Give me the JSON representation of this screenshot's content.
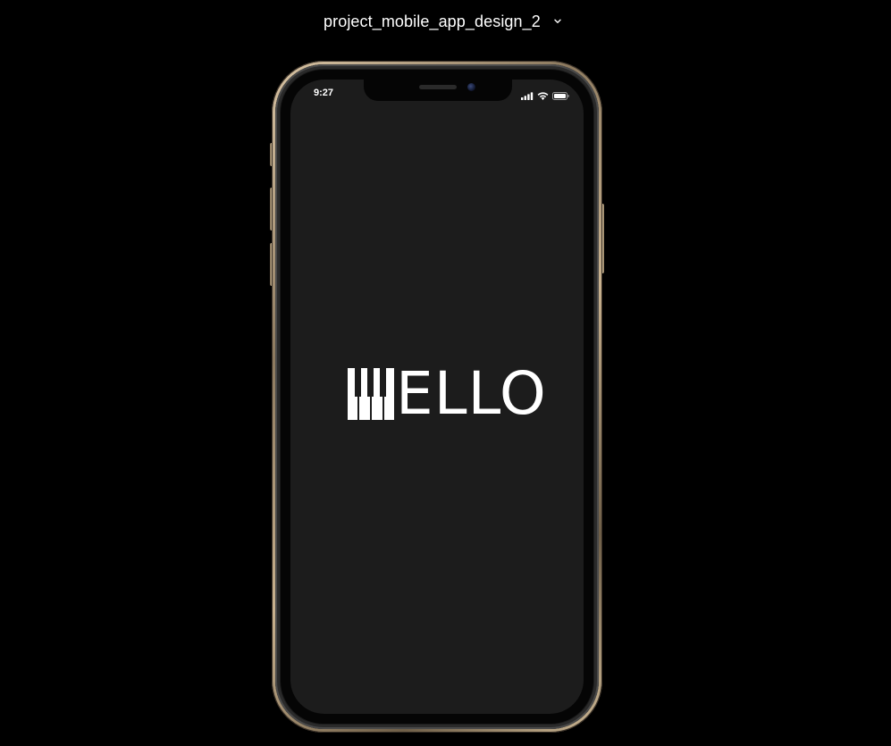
{
  "header": {
    "file_name": "project_mobile_app_design_2",
    "dropdown_icon": "chevron-down-icon"
  },
  "phone": {
    "status_bar": {
      "time": "9:27",
      "icons": [
        "cellular-signal-icon",
        "wifi-icon",
        "battery-icon"
      ]
    },
    "screen": {
      "background": "#1c1c1c",
      "logo": {
        "mark_icon": "piano-keys-icon",
        "text": "ELLO",
        "color": "#ffffff"
      }
    }
  }
}
